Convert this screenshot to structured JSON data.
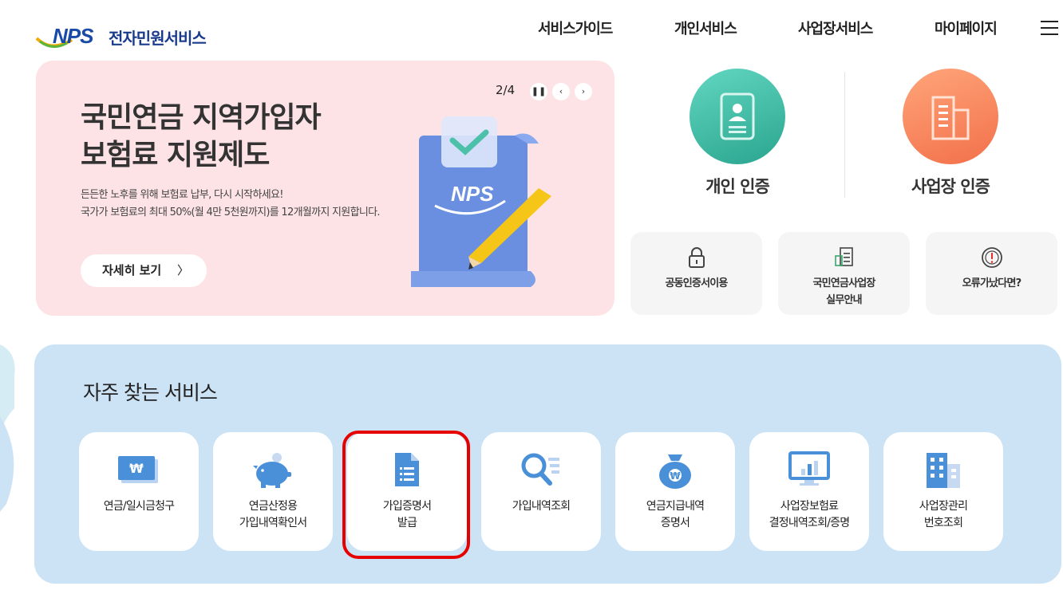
{
  "header": {
    "logo_text": "전자민원서비스",
    "logo_mark": "NPS",
    "nav": [
      "서비스가이드",
      "개인서비스",
      "사업장서비스",
      "마이페이지"
    ]
  },
  "banner": {
    "title_line1": "국민연금 지역가입자",
    "title_line2": "보험료 지원제도",
    "desc_line1": "든든한 노후를 위해 보험료 납부, 다시 시작하세요!",
    "desc_line2": "국가가 보험료의 최대 50%(월 4만 5천원까지)를 12개월까지 지원합니다.",
    "detail_label": "자세히 보기",
    "page_indicator": "2/4"
  },
  "auth": {
    "personal": "개인 인증",
    "business": "사업장 인증"
  },
  "quick_links": [
    {
      "line1": "공동인증서이용",
      "line2": ""
    },
    {
      "line1": "국민연금사업장",
      "line2": "실무안내"
    },
    {
      "line1": "오류가났다면?",
      "line2": ""
    }
  ],
  "services": {
    "title": "자주 찾는 서비스",
    "items": [
      {
        "line1": "연금/일시금청구",
        "line2": ""
      },
      {
        "line1": "연금산정용",
        "line2": "가입내역확인서"
      },
      {
        "line1": "가입증명서",
        "line2": "발급"
      },
      {
        "line1": "가입내역조회",
        "line2": ""
      },
      {
        "line1": "연금지급내역",
        "line2": "증명서"
      },
      {
        "line1": "사업장보험료",
        "line2": "결정내역조회/증명"
      },
      {
        "line1": "사업장관리",
        "line2": "번호조회"
      }
    ]
  },
  "colors": {
    "banner_bg": "#fde3e6",
    "service_panel_bg": "#cce3f6",
    "personal_circle": "#3dbfa8",
    "business_circle": "#f47c4f",
    "highlight": "#e60000",
    "icon_blue": "#4a90d9"
  }
}
